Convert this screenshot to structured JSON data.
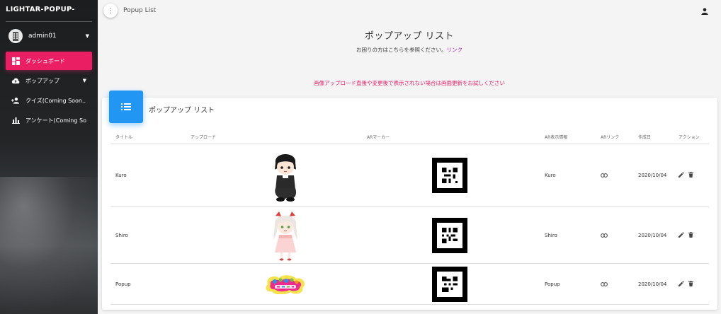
{
  "app": {
    "title": "LIGHTAR-POPUP-"
  },
  "user": {
    "name": "admin01"
  },
  "nav": [
    {
      "label": "ダッシュボード",
      "icon": "dashboard-icon",
      "active": true
    },
    {
      "label": "ポップアップ",
      "icon": "cloud-upload-icon",
      "active": false
    },
    {
      "label": "クイズ(Coming Soon...)",
      "icon": "person-add-icon",
      "active": false
    },
    {
      "label": "アンケート(Coming Soon...)",
      "icon": "bar-chart-icon",
      "active": false
    }
  ],
  "topbar": {
    "title": "Popup List"
  },
  "header": {
    "title": "ポップアップ リスト",
    "help_text": "お困りの方はこちらを参照ください。",
    "help_link": "リンク"
  },
  "warning": "画像アップロード直後や変更後で表示されない場合は画面更新をお試しください",
  "card": {
    "title": "ポップアップ リスト"
  },
  "table": {
    "columns": [
      "タイトル",
      "アップロード",
      "ARマーカー",
      "AR表示情報",
      "ARリンク",
      "作成日",
      "アクション"
    ],
    "rows": [
      {
        "title": "Kuro",
        "upload": "kuro-character-image",
        "ar_info": "Kuro",
        "date": "2020/10/04"
      },
      {
        "title": "Shiro",
        "upload": "shiro-character-image",
        "ar_info": "Shiro",
        "date": "2020/10/04"
      },
      {
        "title": "Popup",
        "upload": "popup-logo-image",
        "ar_info": "Popup",
        "date": "2020/10/04"
      }
    ]
  },
  "colors": {
    "accent": "#e91e63",
    "primary": "#2196f3",
    "link": "#9c27b0"
  }
}
